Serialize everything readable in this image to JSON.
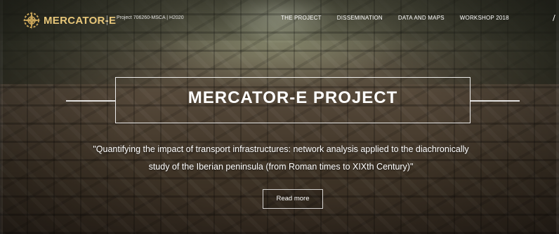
{
  "header": {
    "logo_text": "MERCATOR-E",
    "project_id": "Project 706260-MSCA | H2020",
    "logo_icon": "compass-rose-icon"
  },
  "nav": {
    "items": [
      {
        "label": "THE PROJECT"
      },
      {
        "label": "DISSEMINATION"
      },
      {
        "label": "DATA AND MAPS"
      },
      {
        "label": "WORKSHOP 2018"
      }
    ],
    "overflow": "/"
  },
  "hero": {
    "title": "MERCATOR-E PROJECT",
    "subtitle_line1": "\"Quantifying the impact of transport infrastructures: network analysis applied to the diachronically",
    "subtitle_line2": "study of the Iberian peninsula (from Roman times to XIXth Century)\"",
    "button_label": "Read more"
  },
  "colors": {
    "logo": "#e8c77a",
    "text": "#ffffff"
  }
}
